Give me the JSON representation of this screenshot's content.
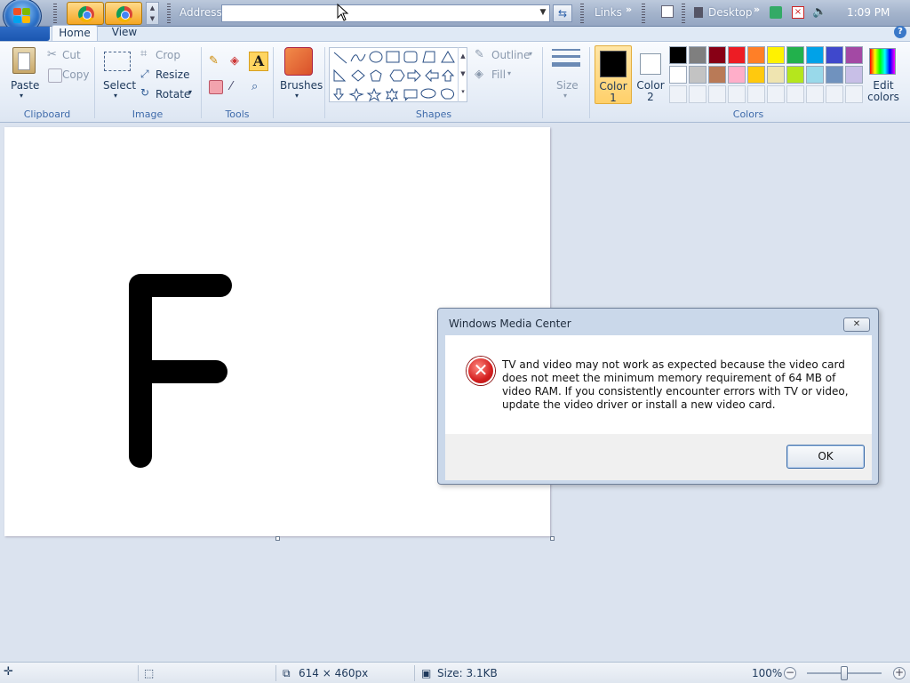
{
  "taskbar": {
    "address_label": "Address",
    "address_value": "",
    "links_label": "Links",
    "desktop_label": "Desktop",
    "clock": "1:09 PM"
  },
  "ribbon": {
    "tabs": [
      {
        "label": "Home"
      },
      {
        "label": "View"
      }
    ],
    "clipboard": {
      "paste": "Paste",
      "cut": "Cut",
      "copy": "Copy",
      "group": "Clipboard"
    },
    "image": {
      "select": "Select",
      "crop": "Crop",
      "resize": "Resize",
      "rotate": "Rotate",
      "group": "Image"
    },
    "tools": {
      "group": "Tools"
    },
    "brushes": {
      "label": "Brushes"
    },
    "shapes": {
      "outline": "Outline",
      "fill": "Fill",
      "group": "Shapes"
    },
    "size": {
      "label": "Size"
    },
    "color1": {
      "label": "Color",
      "num": "1",
      "color": "#000000"
    },
    "color2": {
      "label": "Color",
      "num": "2",
      "color": "#ffffff"
    },
    "colors": {
      "group": "Colors",
      "edit_label1": "Edit",
      "edit_label2": "colors",
      "row1": [
        "#000000",
        "#7f7f7f",
        "#880015",
        "#ed1c24",
        "#ff7f27",
        "#fff200",
        "#22b14c",
        "#00a2e8",
        "#3f48cc",
        "#a349a4"
      ],
      "row2": [
        "#ffffff",
        "#c3c3c3",
        "#b97a57",
        "#ffaec9",
        "#ffc90e",
        "#efe4b0",
        "#b5e61d",
        "#99d9ea",
        "#7092be",
        "#c8bfe7"
      ]
    }
  },
  "canvas": {
    "drawn_letter": "F",
    "background": "#ffffff"
  },
  "dialog": {
    "title": "Windows Media Center",
    "message": "TV and video may not work as expected because the video card does not meet the minimum memory requirement of 64 MB of video RAM. If you consistently encounter errors with TV or video, update the video driver or install a new video card.",
    "ok_label": "OK",
    "icon": "error-icon"
  },
  "status": {
    "dimensions": "614 × 460px",
    "size": "Size: 3.1KB",
    "zoom": "100%",
    "zoom_fraction": 0.5
  }
}
